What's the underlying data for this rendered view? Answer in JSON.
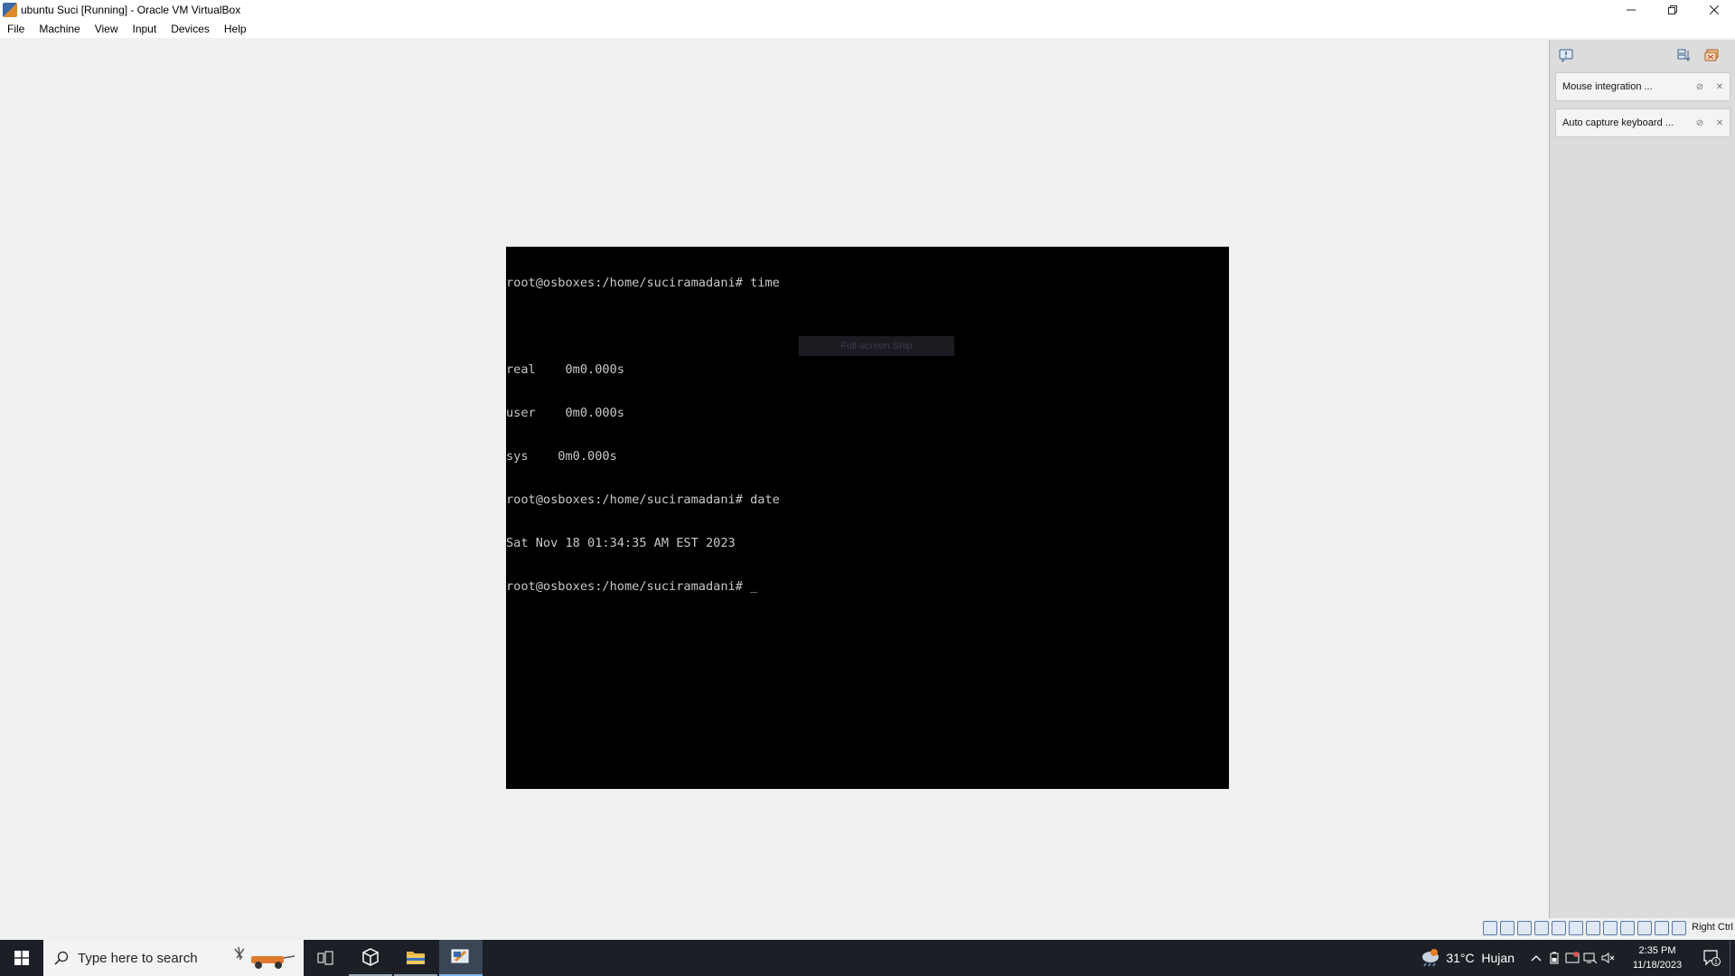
{
  "window": {
    "title": "ubuntu Suci [Running] - Oracle VM VirtualBox",
    "controls": [
      "minimize-icon",
      "restore-icon",
      "close-icon"
    ]
  },
  "menubar": {
    "items": [
      "File",
      "Machine",
      "View",
      "Input",
      "Devices",
      "Help"
    ]
  },
  "console": {
    "lines": [
      "root@osboxes:/home/suciramadani# time",
      "",
      "real\t0m0.000s",
      "user\t0m0.000s",
      "sys\t0m0.000s",
      "root@osboxes:/home/suciramadani# date",
      "Sat Nov 18 01:34:35 AM EST 2023",
      "root@osboxes:/home/suciramadani# _"
    ],
    "overlay_text": "Full-screen Snip"
  },
  "notifications": {
    "items": [
      {
        "label": "Mouse integration ..."
      },
      {
        "label": "Auto capture keyboard ..."
      }
    ]
  },
  "statusbar": {
    "host_key": "Right Ctrl"
  },
  "taskbar": {
    "search_placeholder": "Type here to search",
    "weather": {
      "temp": "31°C",
      "condition": "Hujan"
    },
    "clock": {
      "time": "2:35 PM",
      "date": "11/18/2023"
    },
    "notification_count": "1"
  },
  "colors": {
    "console_bg": "#000000",
    "console_text": "#c8c8c8",
    "taskbar_bg": "#1c2026",
    "accent": "#7cb5ec"
  }
}
